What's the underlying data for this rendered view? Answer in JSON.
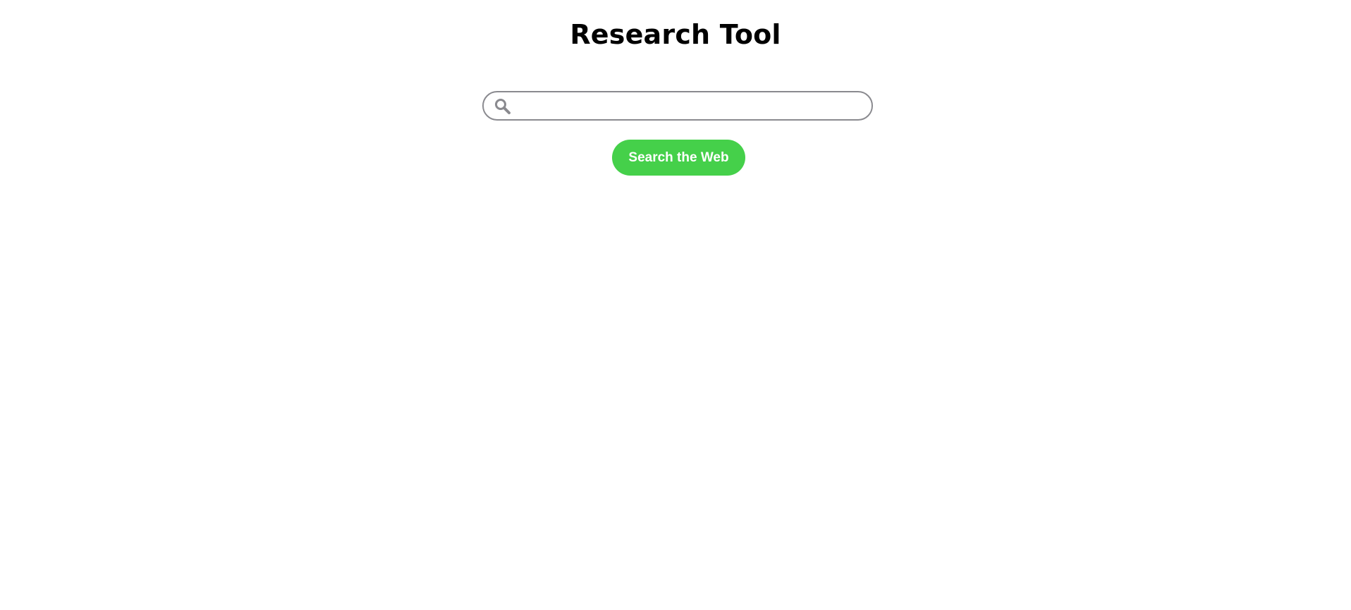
{
  "page": {
    "title": "Research Tool"
  },
  "search": {
    "value": "",
    "placeholder": "",
    "icon": "search-icon",
    "button_label": "Search the Web"
  },
  "colors": {
    "button_background": "#45d04a",
    "button_text": "#ffffff",
    "input_border": "#8a8a8f",
    "icon": "#8a8a8f",
    "title_text": "#000000"
  }
}
